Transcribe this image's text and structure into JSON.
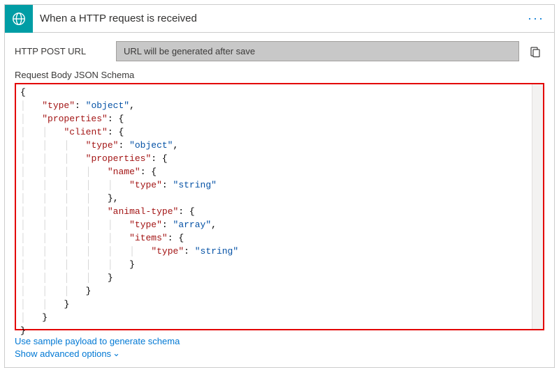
{
  "header": {
    "title": "When a HTTP request is received",
    "menu": "···"
  },
  "url_row": {
    "label": "HTTP POST URL",
    "placeholder": "URL will be generated after save"
  },
  "schema_label": "Request Body JSON Schema",
  "schema_lines": [
    {
      "indent": 0,
      "content": [
        {
          "t": "brace",
          "v": "{"
        }
      ]
    },
    {
      "indent": 1,
      "content": [
        {
          "t": "key",
          "v": "\"type\""
        },
        {
          "t": "colon",
          "v": ": "
        },
        {
          "t": "val-str",
          "v": "\"object\""
        },
        {
          "t": "comma",
          "v": ","
        }
      ]
    },
    {
      "indent": 1,
      "content": [
        {
          "t": "key",
          "v": "\"properties\""
        },
        {
          "t": "colon",
          "v": ": "
        },
        {
          "t": "brace",
          "v": "{"
        }
      ]
    },
    {
      "indent": 2,
      "content": [
        {
          "t": "key",
          "v": "\"client\""
        },
        {
          "t": "colon",
          "v": ": "
        },
        {
          "t": "brace",
          "v": "{"
        }
      ]
    },
    {
      "indent": 3,
      "content": [
        {
          "t": "key",
          "v": "\"type\""
        },
        {
          "t": "colon",
          "v": ": "
        },
        {
          "t": "val-str",
          "v": "\"object\""
        },
        {
          "t": "comma",
          "v": ","
        }
      ]
    },
    {
      "indent": 3,
      "content": [
        {
          "t": "key",
          "v": "\"properties\""
        },
        {
          "t": "colon",
          "v": ": "
        },
        {
          "t": "brace",
          "v": "{"
        }
      ]
    },
    {
      "indent": 4,
      "content": [
        {
          "t": "key",
          "v": "\"name\""
        },
        {
          "t": "colon",
          "v": ": "
        },
        {
          "t": "brace",
          "v": "{"
        }
      ]
    },
    {
      "indent": 5,
      "content": [
        {
          "t": "key",
          "v": "\"type\""
        },
        {
          "t": "colon",
          "v": ": "
        },
        {
          "t": "val-str",
          "v": "\"string\""
        }
      ]
    },
    {
      "indent": 4,
      "content": [
        {
          "t": "brace",
          "v": "}"
        },
        {
          "t": "comma",
          "v": ","
        }
      ]
    },
    {
      "indent": 4,
      "content": [
        {
          "t": "key",
          "v": "\"animal-type\""
        },
        {
          "t": "colon",
          "v": ": "
        },
        {
          "t": "brace",
          "v": "{"
        }
      ]
    },
    {
      "indent": 5,
      "content": [
        {
          "t": "key",
          "v": "\"type\""
        },
        {
          "t": "colon",
          "v": ": "
        },
        {
          "t": "val-str",
          "v": "\"array\""
        },
        {
          "t": "comma",
          "v": ","
        }
      ]
    },
    {
      "indent": 5,
      "content": [
        {
          "t": "key",
          "v": "\"items\""
        },
        {
          "t": "colon",
          "v": ": "
        },
        {
          "t": "brace",
          "v": "{"
        }
      ]
    },
    {
      "indent": 6,
      "content": [
        {
          "t": "key",
          "v": "\"type\""
        },
        {
          "t": "colon",
          "v": ": "
        },
        {
          "t": "val-str",
          "v": "\"string\""
        }
      ]
    },
    {
      "indent": 5,
      "content": [
        {
          "t": "brace",
          "v": "}"
        }
      ]
    },
    {
      "indent": 4,
      "content": [
        {
          "t": "brace",
          "v": "}"
        }
      ]
    },
    {
      "indent": 3,
      "content": [
        {
          "t": "brace",
          "v": "}"
        }
      ]
    },
    {
      "indent": 2,
      "content": [
        {
          "t": "brace",
          "v": "}"
        }
      ]
    },
    {
      "indent": 1,
      "content": [
        {
          "t": "brace",
          "v": "}"
        }
      ]
    },
    {
      "indent": 0,
      "content": [
        {
          "t": "brace",
          "v": "}"
        }
      ]
    }
  ],
  "links": {
    "sample_payload": "Use sample payload to generate schema",
    "advanced": "Show advanced options"
  }
}
